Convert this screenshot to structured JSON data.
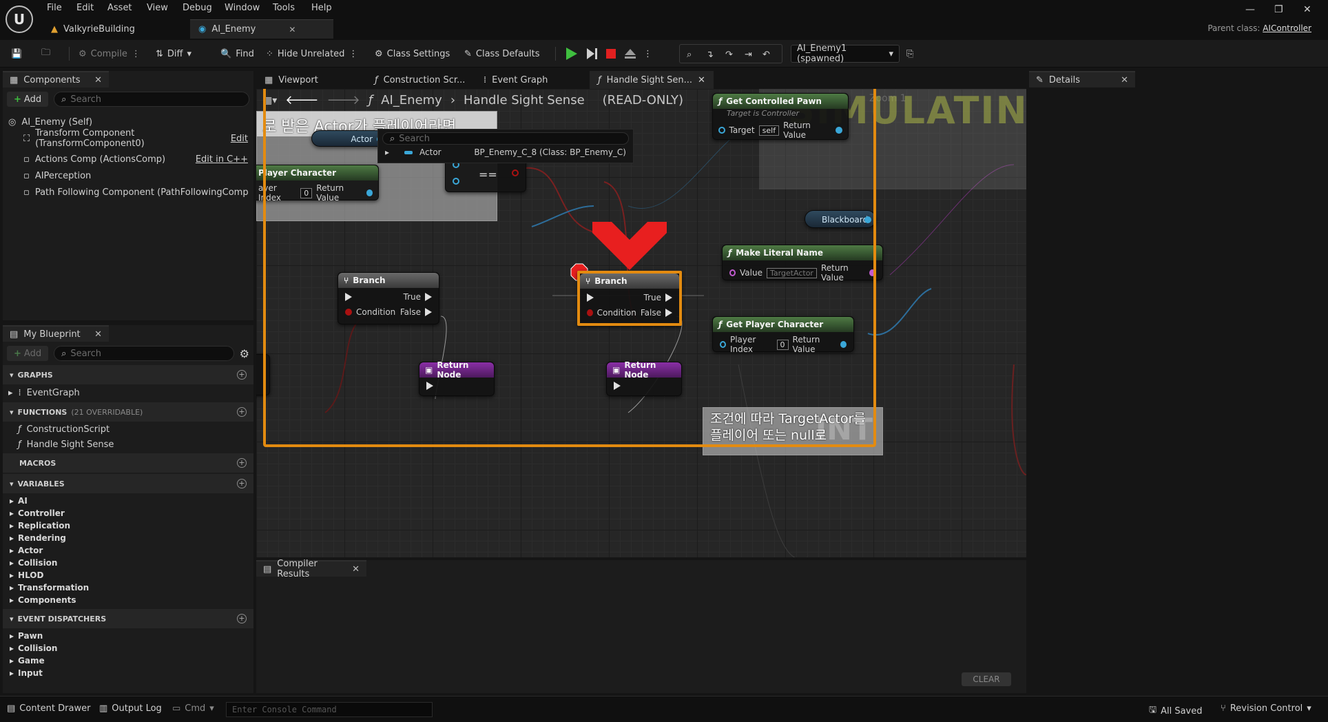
{
  "menu": [
    "File",
    "Edit",
    "Asset",
    "View",
    "Debug",
    "Window",
    "Tools",
    "Help"
  ],
  "doc_tabs": [
    {
      "label": "ValkyrieBuilding"
    },
    {
      "label": "AI_Enemy"
    }
  ],
  "parent_class": {
    "label": "Parent class:",
    "value": "AIController"
  },
  "toolbar": {
    "compile": "Compile",
    "diff": "Diff",
    "find": "Find",
    "hide_unrelated": "Hide Unrelated",
    "class_settings": "Class Settings",
    "class_defaults": "Class Defaults",
    "debug_object": "AI_Enemy1 (spawned)"
  },
  "components_panel": {
    "tab": "Components",
    "add": "Add",
    "search_placeholder": "Search",
    "items": [
      {
        "label": "AI_Enemy (Self)",
        "action": ""
      },
      {
        "label": "Transform Component (TransformComponent0)",
        "action": "Edit"
      },
      {
        "label": "Actions Comp (ActionsComp)",
        "action": "Edit in C++"
      },
      {
        "label": "AIPerception",
        "action": ""
      },
      {
        "label": "Path Following Component (PathFollowingComponent",
        "action": ""
      }
    ]
  },
  "my_blueprint": {
    "tab": "My Blueprint",
    "add": "Add",
    "search_placeholder": "Search",
    "graphs_header": "GRAPHS",
    "graphs": [
      "EventGraph"
    ],
    "functions_header": "FUNCTIONS",
    "functions_sub": "(21 OVERRIDABLE)",
    "functions": [
      "ConstructionScript",
      "Handle Sight Sense"
    ],
    "macros_header": "MACROS",
    "variables_header": "VARIABLES",
    "variables": [
      "AI",
      "Controller",
      "Replication",
      "Rendering",
      "Actor",
      "Collision",
      "HLOD",
      "Transformation",
      "Components"
    ],
    "dispatchers_header": "EVENT DISPATCHERS",
    "dispatchers": [
      "Pawn",
      "Collision",
      "Game",
      "Input"
    ]
  },
  "graph_tabs": [
    "Viewport",
    "Construction Scr...",
    "Event Graph",
    "Handle Sight Sen..."
  ],
  "graph": {
    "breadcrumb": [
      "AI_Enemy",
      "Handle Sight Sense",
      "(READ-ONLY)"
    ],
    "zoom": "Zoom 1",
    "simulating": "SIMULATING",
    "comment1": "로 받은 Actor가 플레이어라면",
    "comment2_line1": "조건에 따라 TargetActor를",
    "comment2_line2": "플레이어 또는 null로",
    "watermark": "INT",
    "actor_pin": "Actor",
    "search_popup": {
      "placeholder": "Search",
      "row_label": "Actor",
      "row_value": "BP_Enemy_C_8 (Class: BP_Enemy_C)"
    },
    "player_char_node": {
      "title": "Player Character",
      "pin_in": "ayer Index",
      "pin_in_val": "0",
      "pin_out": "Return Value"
    },
    "equal_node": {
      "symbol": "=="
    },
    "branch1": {
      "title": "Branch",
      "true": "True",
      "false": "False",
      "condition": "Condition"
    },
    "branch2": {
      "title": "Branch",
      "true": "True",
      "false": "False",
      "condition": "Condition"
    },
    "return1": {
      "title": "Return Node"
    },
    "return2": {
      "title": "Return Node"
    },
    "get_controlled_pawn": {
      "title": "Get Controlled Pawn",
      "subtitle": "Target is Controller",
      "target": "Target",
      "target_val": "self",
      "out": "Return Value"
    },
    "blackboard": {
      "label": "Blackboard"
    },
    "make_literal_name": {
      "title": "Make Literal Name",
      "in": "Value",
      "in_val": "TargetActor",
      "out": "Return Value"
    },
    "get_player_character": {
      "title": "Get Player Character",
      "in": "Player Index",
      "in_val": "0",
      "out": "Return Value"
    }
  },
  "details_panel": {
    "tab": "Details"
  },
  "compiler_panel": {
    "tab": "Compiler Results",
    "clear": "CLEAR"
  },
  "statusbar": {
    "content_drawer": "Content Drawer",
    "output_log": "Output Log",
    "cmd": "Cmd",
    "console_placeholder": "Enter Console Command",
    "all_saved": "All Saved",
    "revision_control": "Revision Control"
  },
  "colors": {
    "accent_orange": "#e38b10",
    "play_green": "#3fbf3f",
    "stop_red": "#e02020",
    "pin_blue": "#3aa7d8"
  }
}
